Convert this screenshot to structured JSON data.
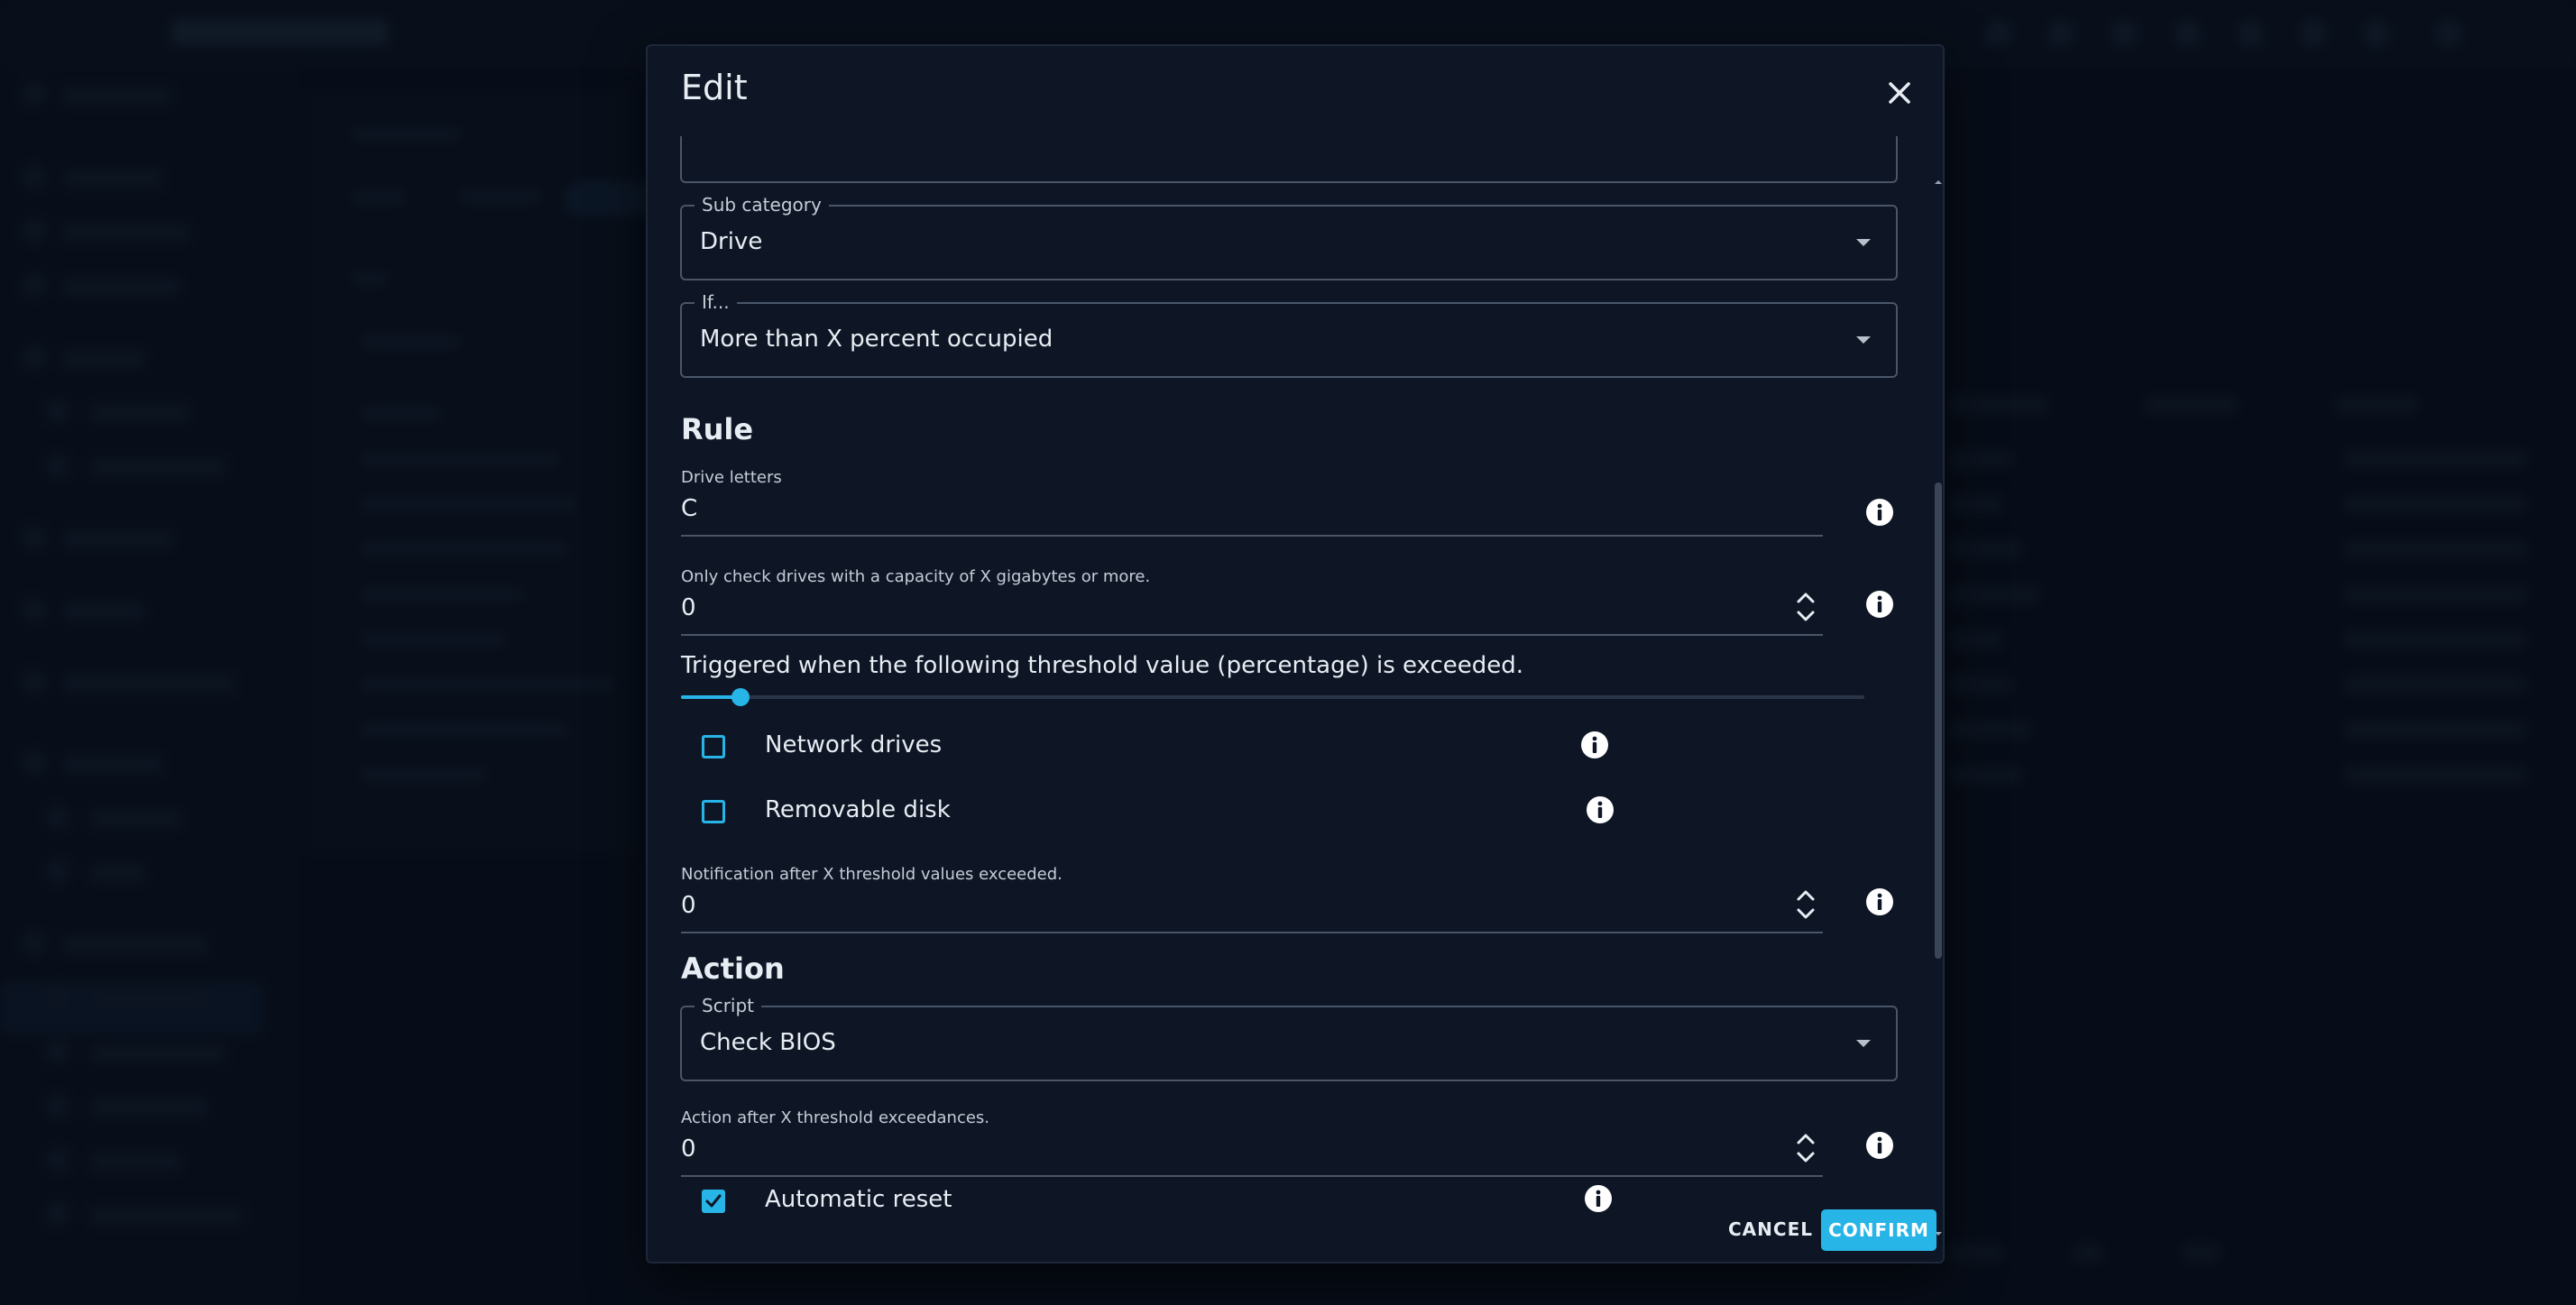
{
  "dialog": {
    "title": "Edit",
    "close_icon": "close-icon"
  },
  "fields": {
    "sub_category": {
      "label": "Sub category",
      "value": "Drive"
    },
    "if_condition": {
      "label": "If...",
      "value": "More than X percent occupied"
    }
  },
  "rule": {
    "heading": "Rule",
    "drive_letters": {
      "label": "Drive letters",
      "value": "C"
    },
    "capacity": {
      "label": "Only check drives with a capacity of X gigabytes or more.",
      "value": "0"
    },
    "threshold": {
      "label": "Triggered when the following threshold value (percentage) is exceeded.",
      "value": 5
    },
    "network_drives": {
      "label": "Network drives",
      "checked": false
    },
    "removable_disk": {
      "label": "Removable disk",
      "checked": false
    },
    "notification_after": {
      "label": "Notification after X threshold values exceeded.",
      "value": "0"
    }
  },
  "action": {
    "heading": "Action",
    "script": {
      "label": "Script",
      "value": "Check BIOS"
    },
    "action_after": {
      "label": "Action after X threshold exceedances.",
      "value": "0"
    },
    "automatic_reset": {
      "label": "Automatic reset",
      "checked": true
    }
  },
  "footer": {
    "cancel_label": "CANCEL",
    "confirm_label": "CONFIRM"
  },
  "colors": {
    "accent": "#27b4e6",
    "dialog_bg": "#0e1626",
    "page_bg": "#0a1220",
    "text": "#e8edf3",
    "outline": "#4a5568"
  }
}
